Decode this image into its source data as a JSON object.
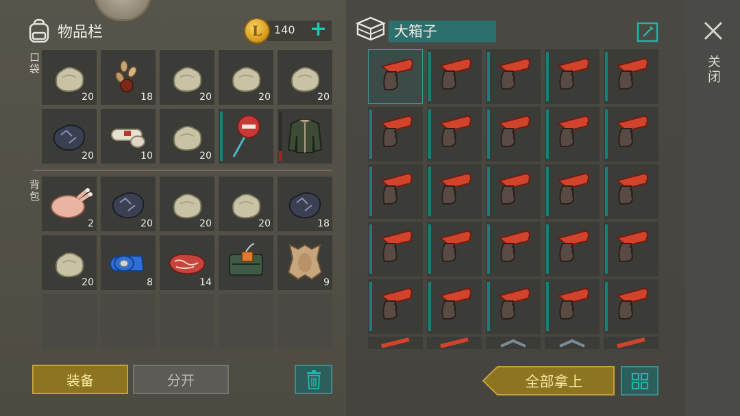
{
  "inventory": {
    "title": "物品栏",
    "coins": "140",
    "pocket_label": "口袋",
    "backpack_label": "背包",
    "pocket": [
      {
        "item": "stone",
        "count": "20"
      },
      {
        "item": "seeds",
        "count": "18"
      },
      {
        "item": "stone",
        "count": "20"
      },
      {
        "item": "stone",
        "count": "20"
      },
      {
        "item": "stone",
        "count": "20"
      },
      {
        "item": "iron-ore",
        "count": "20"
      },
      {
        "item": "bandage",
        "count": "10"
      },
      {
        "item": "stone",
        "count": "20"
      },
      {
        "item": "stop-sign",
        "count": ""
      },
      {
        "item": "jacket",
        "count": ""
      }
    ],
    "backpack": [
      {
        "item": "raw-chicken",
        "count": "2"
      },
      {
        "item": "iron-ore",
        "count": "20"
      },
      {
        "item": "stone",
        "count": "20"
      },
      {
        "item": "stone",
        "count": "20"
      },
      {
        "item": "iron-ore",
        "count": "18"
      },
      {
        "item": "stone",
        "count": "20"
      },
      {
        "item": "duct-tape",
        "count": "8"
      },
      {
        "item": "raw-meat",
        "count": "14"
      },
      {
        "item": "bomb",
        "count": ""
      },
      {
        "item": "leather",
        "count": "9"
      }
    ]
  },
  "box": {
    "name": "大箱子",
    "item": "flare-gun",
    "rows_full": 5,
    "columns": 5
  },
  "close_label": "关闭",
  "buttons": {
    "equip": "装备",
    "split": "分开",
    "take_all": "全部拿上"
  },
  "colors": {
    "accent_teal": "#1fc8b2",
    "gold": "#c6a138"
  }
}
